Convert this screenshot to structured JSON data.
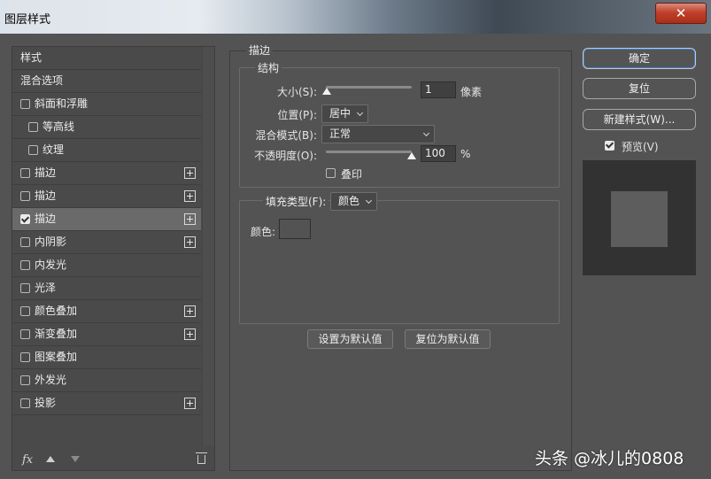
{
  "window": {
    "title": "图层样式",
    "close_glyph": "✕"
  },
  "sidebar": {
    "items": [
      {
        "label": "样式",
        "checkbox": false,
        "checked": false,
        "plus": false,
        "indent": false,
        "selected": false
      },
      {
        "label": "混合选项",
        "checkbox": false,
        "checked": false,
        "plus": false,
        "indent": false,
        "selected": false
      },
      {
        "label": "斜面和浮雕",
        "checkbox": true,
        "checked": false,
        "plus": false,
        "indent": false,
        "selected": false
      },
      {
        "label": "等高线",
        "checkbox": true,
        "checked": false,
        "plus": false,
        "indent": true,
        "selected": false
      },
      {
        "label": "纹理",
        "checkbox": true,
        "checked": false,
        "plus": false,
        "indent": true,
        "selected": false
      },
      {
        "label": "描边",
        "checkbox": true,
        "checked": false,
        "plus": true,
        "indent": false,
        "selected": false
      },
      {
        "label": "描边",
        "checkbox": true,
        "checked": false,
        "plus": true,
        "indent": false,
        "selected": false
      },
      {
        "label": "描边",
        "checkbox": true,
        "checked": true,
        "plus": true,
        "indent": false,
        "selected": true
      },
      {
        "label": "内阴影",
        "checkbox": true,
        "checked": false,
        "plus": true,
        "indent": false,
        "selected": false
      },
      {
        "label": "内发光",
        "checkbox": true,
        "checked": false,
        "plus": false,
        "indent": false,
        "selected": false
      },
      {
        "label": "光泽",
        "checkbox": true,
        "checked": false,
        "plus": false,
        "indent": false,
        "selected": false
      },
      {
        "label": "颜色叠加",
        "checkbox": true,
        "checked": false,
        "plus": true,
        "indent": false,
        "selected": false
      },
      {
        "label": "渐变叠加",
        "checkbox": true,
        "checked": false,
        "plus": true,
        "indent": false,
        "selected": false
      },
      {
        "label": "图案叠加",
        "checkbox": true,
        "checked": false,
        "plus": false,
        "indent": false,
        "selected": false
      },
      {
        "label": "外发光",
        "checkbox": true,
        "checked": false,
        "plus": false,
        "indent": false,
        "selected": false
      },
      {
        "label": "投影",
        "checkbox": true,
        "checked": false,
        "plus": true,
        "indent": false,
        "selected": false
      }
    ],
    "fx_label": "fx",
    "icons": [
      "fx-icon",
      "move-up-icon",
      "move-down-icon",
      "trash-icon"
    ]
  },
  "stroke": {
    "section_title": "描边",
    "structure_title": "结构",
    "size_label": "大小(S):",
    "size_value": "1",
    "size_unit": "像素",
    "position_label": "位置(P):",
    "position_value": "居中",
    "blend_label": "混合模式(B):",
    "blend_value": "正常",
    "opacity_label": "不透明度(O):",
    "opacity_value": "100",
    "opacity_unit": "%",
    "overprint_label": "叠印",
    "fill_type_label": "填充类型(F):",
    "fill_type_value": "颜色",
    "color_label": "颜色:",
    "set_default_label": "设置为默认值",
    "reset_default_label": "复位为默认值"
  },
  "actions": {
    "ok_label": "确定",
    "reset_label": "复位",
    "new_style_label": "新建样式(W)...",
    "preview_label": "预览(V)",
    "preview_checked": true
  },
  "watermark": "头条 @冰儿的0808",
  "colors": {
    "panel_bg": "#535353",
    "preview_bg": "#323232",
    "preview_swatch": "#5d5d5d",
    "close_red": "#c0412b"
  }
}
